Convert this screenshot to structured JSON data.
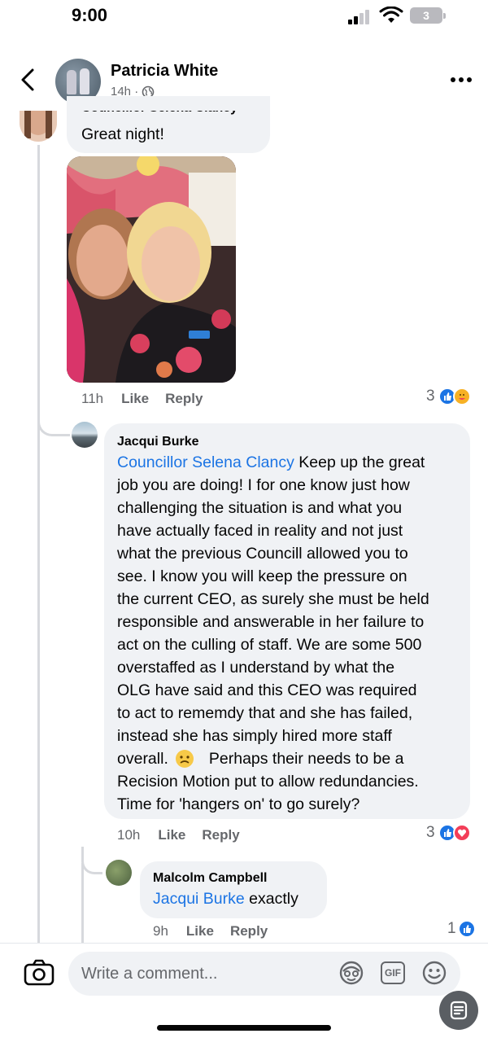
{
  "status_bar": {
    "time": "9:00",
    "battery": "3",
    "icons": [
      "cellular-signal-icon",
      "wifi-icon",
      "battery-icon"
    ]
  },
  "header": {
    "name": "Patricia White",
    "time": "14h ·",
    "icons": [
      "back-arrow-icon",
      "globe-icon",
      "more-icon"
    ]
  },
  "comments": [
    {
      "author": "Councillor Selena Clancy",
      "text": "Great night!",
      "time": "11h",
      "like_label": "Like",
      "reply_label": "Reply",
      "reaction_count": "3",
      "reactions": [
        "like",
        "care"
      ]
    },
    {
      "author": "Jacqui Burke",
      "tag": "Councillor Selena Clancy",
      "text_lines": [
        "Keep up the great",
        "job you are doing! I for one know just how",
        "challenging the situation is and what you",
        "have actually faced in reality and not just",
        "what the previous Councill allowed you to",
        "see. I know you will keep the pressure on",
        "the current CEO, as surely she must be held",
        "responsible and answerable in her failure to",
        "act on the culling of staff. We are some 500",
        "overstaffed as I understand by what the",
        "OLG have said and this CEO was  required",
        "to act to rememdy that and she has failed,",
        "instead she has simply hired more staff",
        "overall.",
        "Perhaps their needs to be a",
        "Recision Motion put to allow redundancies.",
        "Time for 'hangers on' to go surely?"
      ],
      "time": "10h",
      "like_label": "Like",
      "reply_label": "Reply",
      "reaction_count": "3",
      "reactions": [
        "like",
        "love"
      ]
    },
    {
      "author": "Malcolm Campbell",
      "tag": "Jacqui Burke",
      "text": "exactly",
      "time": "9h",
      "like_label": "Like",
      "reply_label": "Reply",
      "reaction_count": "1",
      "reactions": [
        "like"
      ]
    }
  ],
  "composer": {
    "placeholder": "Write a comment...",
    "gif_label": "GIF",
    "icons": [
      "camera-icon",
      "avatar-sticker-icon",
      "gif-icon",
      "emoji-icon",
      "floating-action-icon"
    ]
  },
  "colors": {
    "link": "#1b74e4",
    "bubble": "#f0f2f5",
    "secondary_text": "#65676b",
    "love": "#f33e58",
    "care": "#f7b125"
  }
}
